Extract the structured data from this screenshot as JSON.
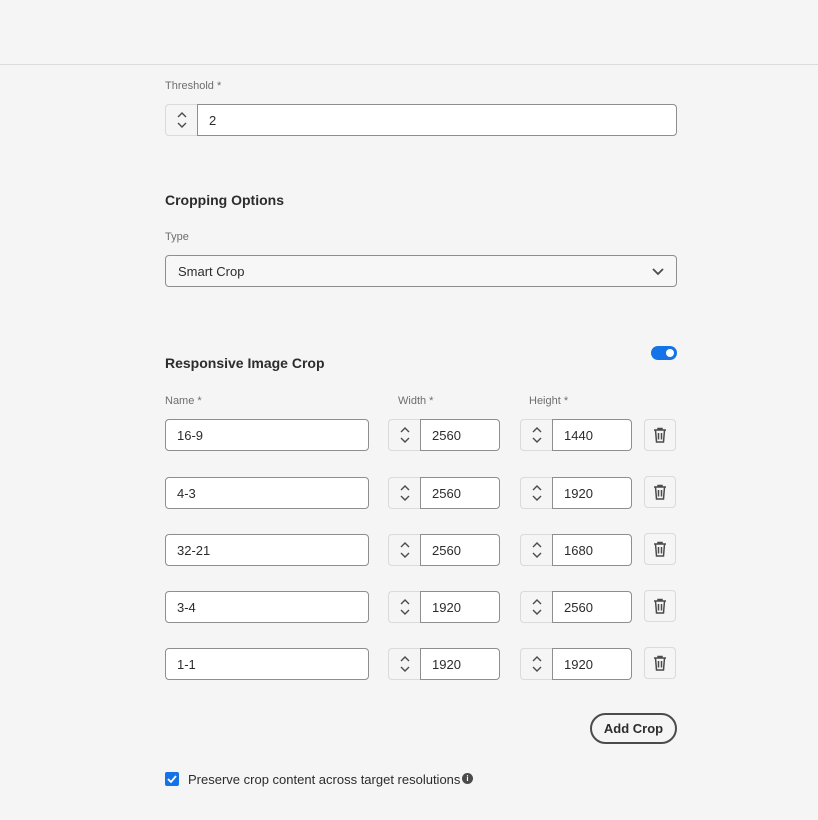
{
  "threshold": {
    "label": "Threshold *",
    "value": "2"
  },
  "cropping": {
    "title": "Cropping Options",
    "type_label": "Type",
    "type_value": "Smart Crop"
  },
  "responsive": {
    "title": "Responsive Image Crop",
    "toggle_on": true,
    "headers": {
      "name": "Name *",
      "width": "Width *",
      "height": "Height *"
    },
    "rows": [
      {
        "name": "16-9",
        "width": "2560",
        "height": "1440"
      },
      {
        "name": "4-3",
        "width": "2560",
        "height": "1920"
      },
      {
        "name": "32-21",
        "width": "2560",
        "height": "1680"
      },
      {
        "name": "3-4",
        "width": "1920",
        "height": "2560"
      },
      {
        "name": "1-1",
        "width": "1920",
        "height": "1920"
      }
    ],
    "add_label": "Add Crop"
  },
  "preserve": {
    "label": "Preserve crop content across target resolutions",
    "checked": true
  },
  "colors": {
    "accent": "#1473e6",
    "border": "#8e8e8e",
    "background": "#f5f5f5"
  },
  "icons": {
    "stepper": "chevron-up-down-icon",
    "delete": "trash-icon",
    "dropdown": "chevron-down-icon",
    "info": "info-icon",
    "check": "checkmark-icon"
  }
}
